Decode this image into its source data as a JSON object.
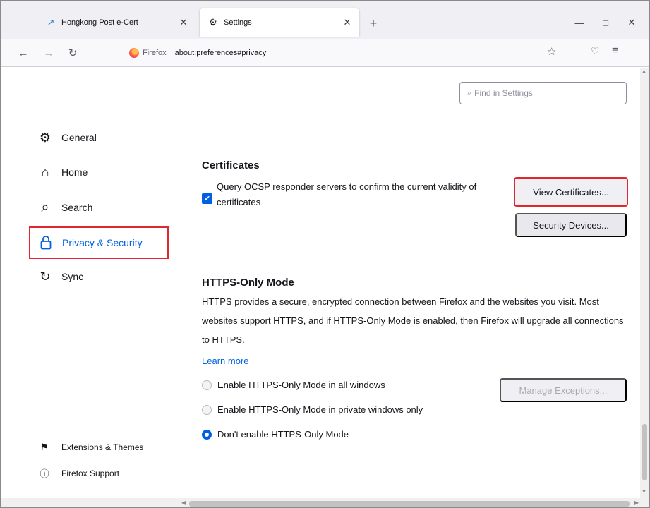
{
  "tabs": [
    {
      "title": "Hongkong Post e-Cert",
      "icon": "link-icon",
      "active": false
    },
    {
      "title": "Settings",
      "icon": "gear-icon",
      "active": true
    }
  ],
  "nav": {
    "brand": "Firefox",
    "url": "about:preferences#privacy"
  },
  "search": {
    "placeholder": "Find in Settings"
  },
  "sidebar": {
    "items": [
      {
        "label": "General",
        "icon": "gear-icon"
      },
      {
        "label": "Home",
        "icon": "home-icon"
      },
      {
        "label": "Search",
        "icon": "search-icon"
      },
      {
        "label": "Privacy & Security",
        "icon": "lock-icon",
        "selected": true
      },
      {
        "label": "Sync",
        "icon": "sync-icon"
      }
    ],
    "footer": [
      {
        "label": "Extensions & Themes",
        "icon": "puzzle-icon"
      },
      {
        "label": "Firefox Support",
        "icon": "help-icon"
      }
    ]
  },
  "certificates": {
    "heading": "Certificates",
    "ocsp_label": "Query OCSP responder servers to confirm the current validity of certificates",
    "ocsp_checked": true,
    "view_button": "View Certificates...",
    "devices_button": "Security Devices..."
  },
  "https_only": {
    "heading": "HTTPS-Only Mode",
    "description": "HTTPS provides a secure, encrypted connection between Firefox and the websites you visit. Most websites support HTTPS, and if HTTPS-Only Mode is enabled, then Firefox will upgrade all connections to HTTPS.",
    "learn_more": "Learn more",
    "options": [
      {
        "label": "Enable HTTPS-Only Mode in all windows",
        "checked": false
      },
      {
        "label": "Enable HTTPS-Only Mode in private windows only",
        "checked": false
      },
      {
        "label": "Don't enable HTTPS-Only Mode",
        "checked": true
      }
    ],
    "manage_button": "Manage Exceptions..."
  },
  "colors": {
    "accent": "#0061e0",
    "highlight": "#e0262f"
  }
}
